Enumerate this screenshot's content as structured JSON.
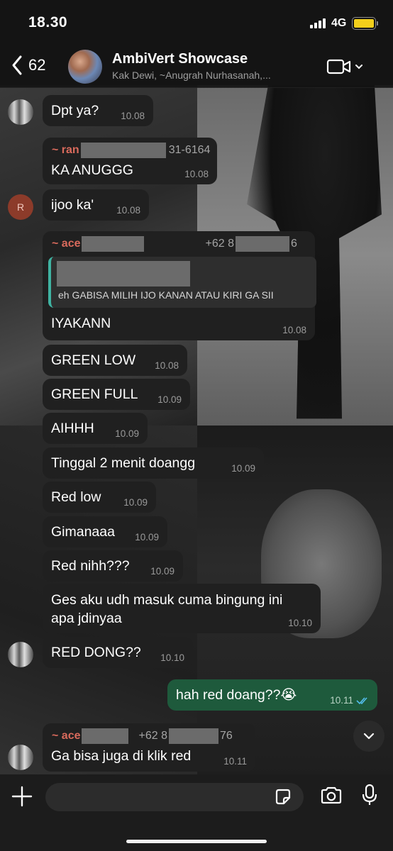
{
  "status_bar": {
    "time": "18.30",
    "network": "4G"
  },
  "header": {
    "back_count": "62",
    "title": "AmbiVert Showcase",
    "subtitle": "Kak Dewi, ~Anugrah Nurhasanah,..."
  },
  "messages": [
    {
      "text": "Dpt ya?",
      "time": "10.08"
    },
    {
      "sender_prefix": "~ ran",
      "sender_suffix": "31-6164",
      "text": "KA ANUGGG",
      "time": "10.08"
    },
    {
      "avatar_letter": "R",
      "text": "ijoo ka'",
      "time": "10.08"
    },
    {
      "sender_prefix": "~ ace",
      "phone_prefix": "+62 8",
      "phone_suffix": "6",
      "quoted_text": "eh GABISA MILIH IJO KANAN ATAU KIRI GA SII",
      "text": "IYAKANN",
      "time": "10.08"
    },
    {
      "text": "GREEN LOW",
      "time": "10.08"
    },
    {
      "text": "GREEN FULL",
      "time": "10.09"
    },
    {
      "text": "AIHHH",
      "time": "10.09"
    },
    {
      "text": "Tinggal 2 menit doangg",
      "time": "10.09"
    },
    {
      "text": "Red low",
      "time": "10.09"
    },
    {
      "text": "Gimanaaa",
      "time": "10.09"
    },
    {
      "text": "Red nihh???",
      "time": "10.09"
    },
    {
      "text_line1": "Ges aku udh masuk cuma bingung ini",
      "text_line2": "apa jdinyaa",
      "time": "10.10"
    },
    {
      "text": "RED DONG??",
      "time": "10.10"
    },
    {
      "text": "hah red doang??😭",
      "time": "10.11",
      "outgoing": true
    },
    {
      "sender_prefix": "~ ace",
      "phone_prefix": "+62 8",
      "phone_suffix": "76",
      "text": "Ga bisa juga di klik red",
      "time": "10.11"
    }
  ],
  "input": {
    "placeholder": ""
  },
  "colors": {
    "outgoing_bubble": "#1e5a3c",
    "incoming_bubble": "#202020",
    "sender_name": "#d96a5c",
    "quote_bar": "#3fb3a2",
    "read_ticks": "#53bdeb",
    "battery": "#f3cf1b"
  }
}
